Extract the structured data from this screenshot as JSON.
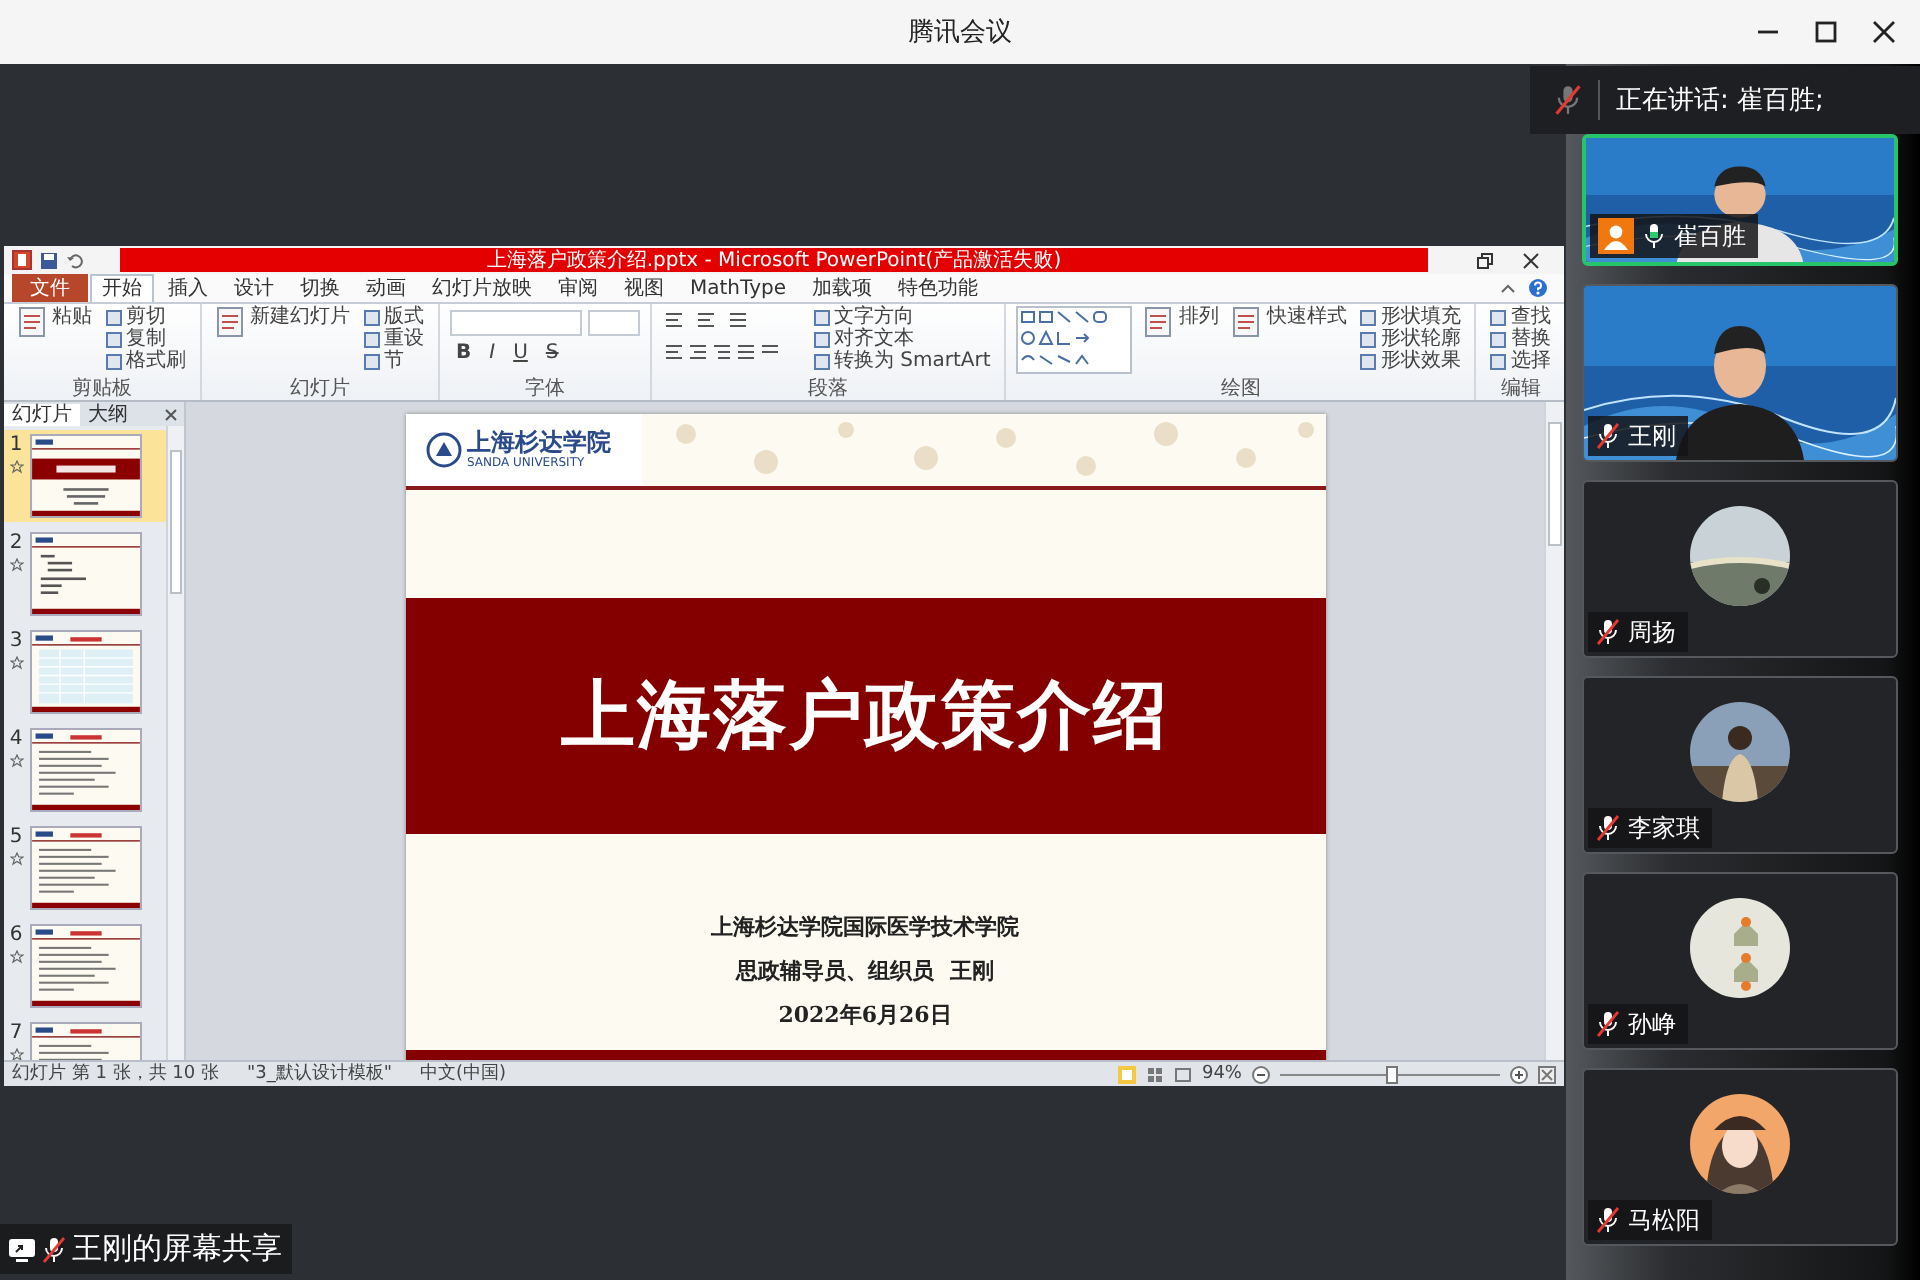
{
  "window": {
    "title": "腾讯会议"
  },
  "speaking": {
    "label": "正在讲话: 崔百胜;",
    "muted": true
  },
  "shared_window": {
    "title": "上海落户政策介绍.pptx - Microsoft PowerPoint(产品激活失败)",
    "ribbon_tabs": [
      {
        "label": "文件",
        "kind": "file",
        "selected": false
      },
      {
        "label": "开始",
        "kind": "tab",
        "selected": true
      },
      {
        "label": "插入",
        "kind": "tab",
        "selected": false
      },
      {
        "label": "设计",
        "kind": "tab",
        "selected": false
      },
      {
        "label": "切换",
        "kind": "tab",
        "selected": false
      },
      {
        "label": "动画",
        "kind": "tab",
        "selected": false
      },
      {
        "label": "幻灯片放映",
        "kind": "tab",
        "selected": false
      },
      {
        "label": "审阅",
        "kind": "tab",
        "selected": false
      },
      {
        "label": "视图",
        "kind": "tab",
        "selected": false
      },
      {
        "label": "MathType",
        "kind": "tab",
        "selected": false
      },
      {
        "label": "加载项",
        "kind": "tab",
        "selected": false
      },
      {
        "label": "特色功能",
        "kind": "tab",
        "selected": false
      }
    ],
    "ribbon_groups": [
      {
        "label": "剪贴板",
        "kind": "plain",
        "items": [
          {
            "label": "粘贴",
            "kind": "large"
          },
          {
            "label": "剪切",
            "kind": "small"
          },
          {
            "label": "复制",
            "kind": "small"
          },
          {
            "label": "格式刷",
            "kind": "small"
          }
        ]
      },
      {
        "label": "幻灯片",
        "kind": "plain",
        "items": [
          {
            "label": "新建幻灯片",
            "kind": "large"
          },
          {
            "label": "版式",
            "kind": "small"
          },
          {
            "label": "重设",
            "kind": "small"
          },
          {
            "label": "节",
            "kind": "small"
          }
        ]
      },
      {
        "label": "字体",
        "kind": "font",
        "items": [
          {
            "label": "B"
          },
          {
            "label": "I"
          },
          {
            "label": "U"
          },
          {
            "label": "S"
          }
        ]
      },
      {
        "label": "段落",
        "kind": "paragraph",
        "items": [
          {
            "label": "文字方向",
            "kind": "small"
          },
          {
            "label": "对齐文本",
            "kind": "small"
          },
          {
            "label": "转换为 SmartArt",
            "kind": "small"
          }
        ]
      },
      {
        "label": "绘图",
        "kind": "drawing",
        "items": [
          {
            "label": "排列",
            "kind": "large"
          },
          {
            "label": "快速样式",
            "kind": "large"
          },
          {
            "label": "形状填充",
            "kind": "small"
          },
          {
            "label": "形状轮廓",
            "kind": "small"
          },
          {
            "label": "形状效果",
            "kind": "small"
          }
        ]
      },
      {
        "label": "编辑",
        "kind": "plain",
        "items": [
          {
            "label": "查找",
            "kind": "small"
          },
          {
            "label": "替换",
            "kind": "small"
          },
          {
            "label": "选择",
            "kind": "small"
          }
        ]
      }
    ],
    "panel_tabs": [
      {
        "label": "幻灯片",
        "selected": true
      },
      {
        "label": "大纲",
        "selected": false
      }
    ],
    "thumbnails": [
      {
        "number": "1",
        "kind": "title",
        "selected": true
      },
      {
        "number": "2",
        "kind": "list",
        "selected": false
      },
      {
        "number": "3",
        "kind": "table",
        "selected": false
      },
      {
        "number": "4",
        "kind": "text",
        "selected": false
      },
      {
        "number": "5",
        "kind": "text",
        "selected": false
      },
      {
        "number": "6",
        "kind": "text",
        "selected": false
      },
      {
        "number": "7",
        "kind": "text",
        "selected": false
      }
    ],
    "slide": {
      "logo_cn": "上海杉达学院",
      "logo_en": "SANDA UNIVERSITY",
      "title": "上海落户政策介绍",
      "lines": [
        "上海杉达学院国际医学技术学院",
        "思政辅导员、组织员  王刚",
        "2022年6月26日"
      ]
    },
    "status_bar": {
      "items": [
        "幻灯片 第 1 张，共 10 张",
        "\"3_默认设计模板\"",
        "中文(中国)"
      ],
      "zoom": "94%",
      "zoom_slider": {
        "level": 0.5
      }
    }
  },
  "share_label": "王刚的屏幕共享",
  "participants": [
    {
      "name": "崔百胜",
      "kind": "video",
      "muted": false,
      "host": true,
      "speaking": true
    },
    {
      "name": "王刚",
      "kind": "video",
      "muted": true,
      "host": false,
      "speaking": false
    },
    {
      "name": "周扬",
      "kind": "avatar",
      "muted": true,
      "host": false,
      "speaking": false
    },
    {
      "name": "李家琪",
      "kind": "avatar",
      "muted": true,
      "host": false,
      "speaking": false
    },
    {
      "name": "孙峥",
      "kind": "avatar",
      "muted": true,
      "host": false,
      "speaking": false
    },
    {
      "name": "马松阳",
      "kind": "avatar",
      "muted": true,
      "host": false,
      "speaking": false
    }
  ]
}
